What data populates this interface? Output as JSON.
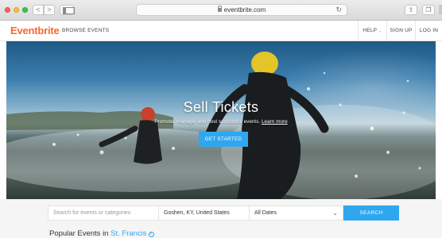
{
  "browser": {
    "url": "eventbrite.com",
    "back_icon": "chevron-left-icon",
    "forward_icon": "chevron-right-icon",
    "back_glyph": "<",
    "forward_glyph": ">",
    "reload_glyph": "↻",
    "share_glyph": "⇧",
    "tabs_glyph": "❐"
  },
  "header": {
    "logo": "Eventbrite",
    "browse": "BROWSE EVENTS",
    "help": "HELP",
    "sign_up": "SIGN UP",
    "log_in": "LOG IN"
  },
  "hero": {
    "title": "Sell Tickets",
    "subtitle": "Promote, manage, and host successful events.",
    "link": "Learn more",
    "cta": "GET STARTED"
  },
  "search": {
    "placeholder": "Search for events or categories",
    "location": "Goshen, KY, United States",
    "date": "All Dates",
    "button": "SEARCH"
  },
  "popular": {
    "prefix": "Popular Events in",
    "city": "St. Francis",
    "icon_glyph": "×"
  },
  "colors": {
    "brand": "#f6682f",
    "accent": "#2fa7ef"
  }
}
